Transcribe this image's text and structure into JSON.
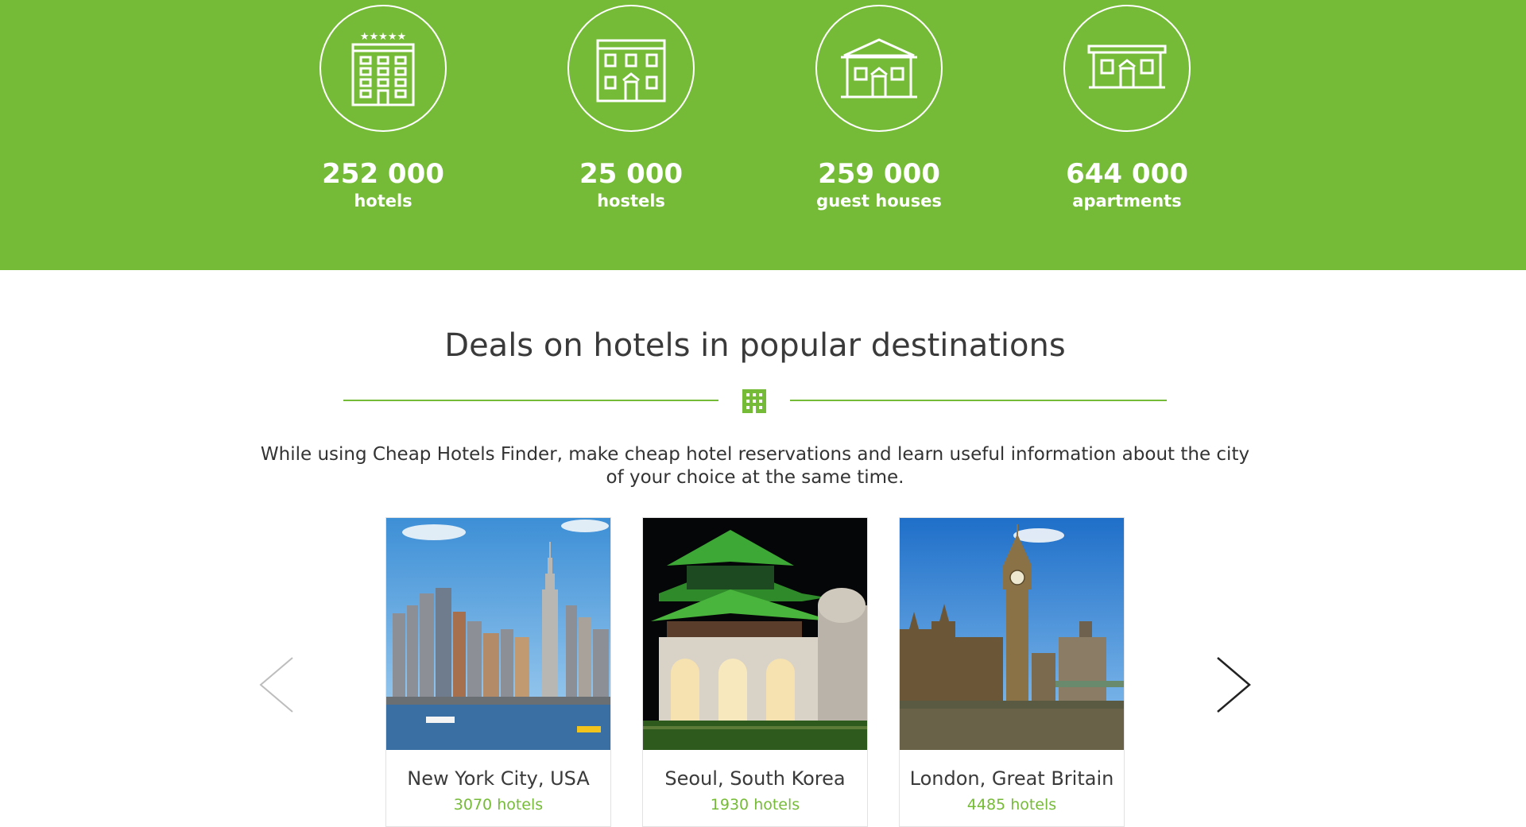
{
  "colors": {
    "accent": "#76bb37",
    "text": "#333333"
  },
  "stats": [
    {
      "icon": "hotel-building-icon",
      "value": "252 000",
      "label": "hotels"
    },
    {
      "icon": "hostel-building-icon",
      "value": "25 000",
      "label": "hostels"
    },
    {
      "icon": "guest-house-icon",
      "value": "259 000",
      "label": "guest houses"
    },
    {
      "icon": "apartment-icon",
      "value": "644 000",
      "label": "apartments"
    }
  ],
  "section": {
    "title": "Deals on hotels in popular destinations",
    "divider_icon": "building-icon",
    "intro": "While using Cheap Hotels Finder, make cheap hotel reservations and learn useful information about the city of your choice at the same time."
  },
  "carousel": {
    "prev_icon": "chevron-left-icon",
    "next_icon": "chevron-right-icon",
    "cards": [
      {
        "name": "New York City, USA",
        "count": "3070 hotels",
        "photo": "new-york-skyline-photo"
      },
      {
        "name": "Seoul, South Korea",
        "count": "1930 hotels",
        "photo": "seoul-palace-gate-photo"
      },
      {
        "name": "London, Great Britain",
        "count": "4485 hotels",
        "photo": "london-big-ben-photo"
      }
    ]
  }
}
